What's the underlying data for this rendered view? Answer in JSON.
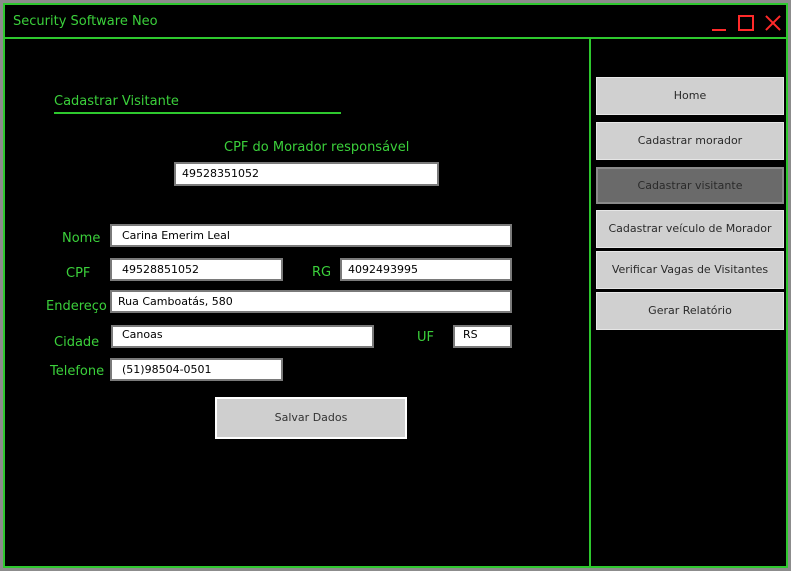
{
  "window": {
    "title": "Security Software Neo",
    "accent_color": "#2ec82e",
    "control_color": "#ff2a2a"
  },
  "form": {
    "section_title": "Cadastrar Visitante",
    "resident_cpf": {
      "label": "CPF do Morador responsável",
      "value": "49528351052"
    },
    "fields": {
      "nome": {
        "label": "Nome",
        "value": "Carina Emerim Leal"
      },
      "cpf": {
        "label": "CPF",
        "value": "49528851052"
      },
      "rg": {
        "label": "RG",
        "value": "4092493995"
      },
      "endereco": {
        "label": "Endereço",
        "value": "Rua Camboatás, 580"
      },
      "cidade": {
        "label": "Cidade",
        "value": "Canoas"
      },
      "uf": {
        "label": "UF",
        "value": "RS"
      },
      "telefone": {
        "label": "Telefone",
        "value": "(51)98504-0501"
      }
    },
    "save_label": "Salvar Dados"
  },
  "sidebar": {
    "items": [
      {
        "label": "Home",
        "active": false
      },
      {
        "label": "Cadastrar morador",
        "active": false
      },
      {
        "label": "Cadastrar visitante",
        "active": true
      },
      {
        "label": "Cadastrar veículo de Morador",
        "active": false
      },
      {
        "label": "Verificar Vagas de Visitantes",
        "active": false
      },
      {
        "label": "Gerar Relatório",
        "active": false
      }
    ]
  }
}
